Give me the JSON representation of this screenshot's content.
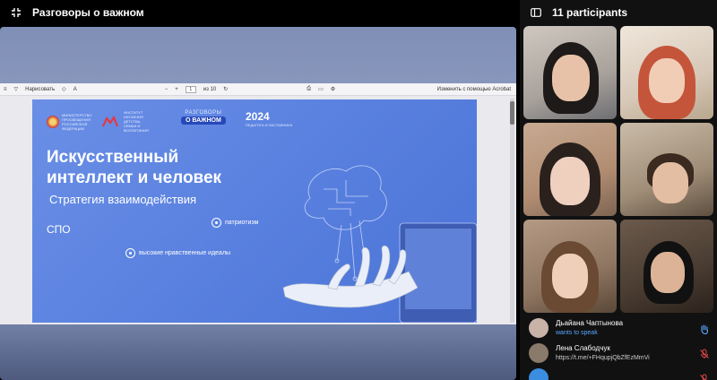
{
  "header": {
    "title": "Разговоры о важном"
  },
  "pdf_toolbar": {
    "draw_label": "Нарисовать",
    "page_current": "1",
    "page_total": "из 10",
    "acrobat_label": "Изменить с помощью Acrobat"
  },
  "slide": {
    "logo1_text": "МИНИСТЕРСТВО ПРОСВЕЩЕНИЯ РОССИЙСКОЙ ФЕДЕРАЦИИ",
    "logo2_text": "ИНСТИТУТ ИЗУЧЕНИЯ ДЕТСТВА, СЕМЬИ И ВОСПИТАНИЯ",
    "brand_top": "РАЗГОВОРЫ",
    "brand_bottom": "О ВАЖНОМ",
    "year": "2024",
    "year_sub": "ПЕДАГОГА И НАСТАВНИКА",
    "title_line1": "Искусственный",
    "title_line2": "интеллект и человек",
    "subtitle": "Стратегия взаимодействия",
    "level": "СПО",
    "tag1": "патриотизм",
    "tag2": "высокие нравственные идеалы"
  },
  "panel": {
    "title": "11 participants"
  },
  "participants": [
    {
      "name": "Дьайана Чаптынова",
      "status": "wants to speak",
      "avatar_color": "#c9b2a8"
    },
    {
      "name": "Лена Слабодчук",
      "status": "https://t.me/+FHqupjQbZfEzMmVi",
      "avatar_color": "#8a7a6a"
    },
    {
      "name": "",
      "status": "",
      "avatar_color": "#3a8de0"
    }
  ],
  "colors": {
    "accent_blue": "#5aa8ff",
    "mic_off_red": "#e04848",
    "slide_blue": "#5b82e0"
  }
}
